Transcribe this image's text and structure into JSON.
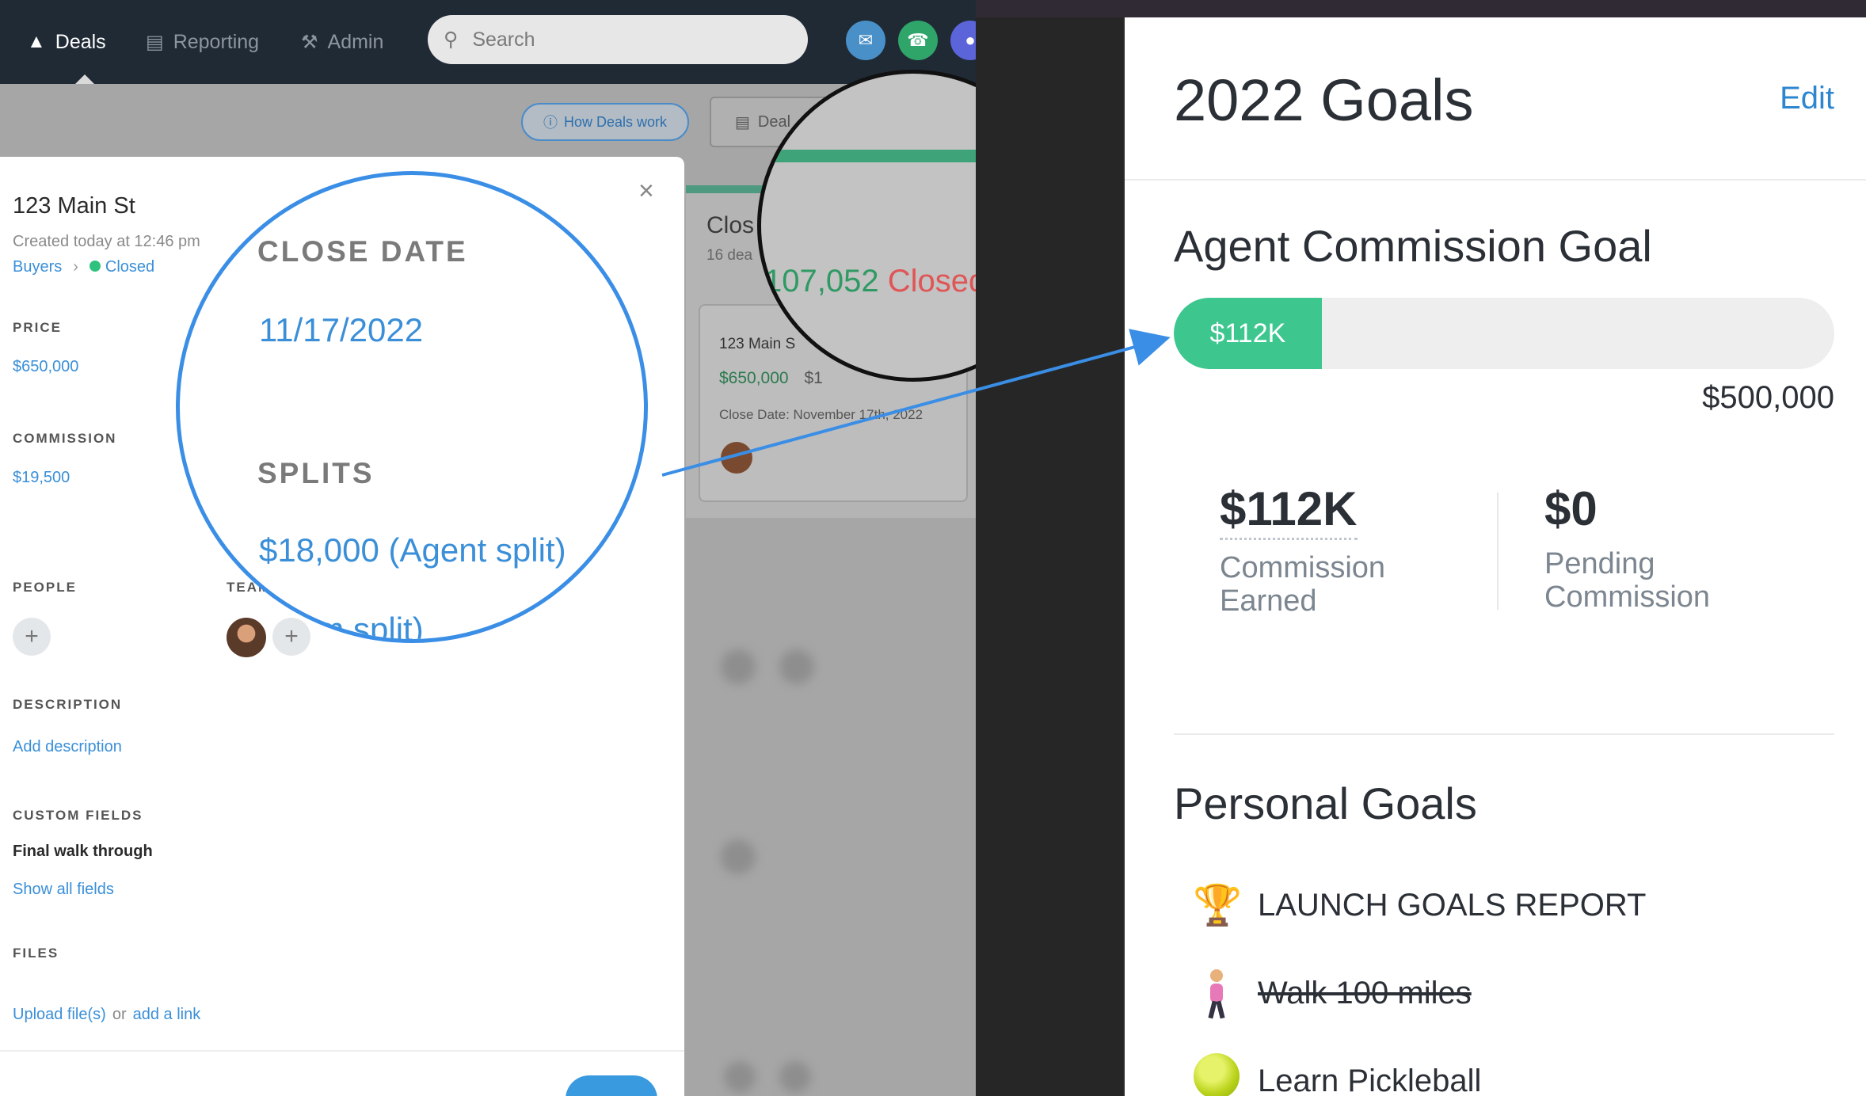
{
  "nav": {
    "items": [
      {
        "label": "Deals",
        "icon": "deals-icon",
        "active": true
      },
      {
        "label": "Reporting",
        "icon": "chart-icon",
        "active": false
      },
      {
        "label": "Admin",
        "icon": "wrench-icon",
        "active": false
      }
    ],
    "search_placeholder": "Search",
    "action_icons": [
      "mail-icon",
      "phone-icon",
      "chat-icon"
    ]
  },
  "toolbar": {
    "how_deals_work": "How Deals work",
    "deals_button": "Deal"
  },
  "board": {
    "column_title": "Clos",
    "column_sub": "16 dea",
    "card_title": "123 Main S",
    "card_price": "$650,000",
    "card_split": "$1",
    "card_close_date": "Close Date: November 17th, 2022"
  },
  "deal": {
    "title": "123 Main St",
    "created": "Created today at 12:46 pm",
    "pipeline": "Buyers",
    "stage": "Closed",
    "price_label": "PRICE",
    "price": "$650,000",
    "commission_label": "COMMISSION",
    "commission": "$19,500",
    "people_label": "PEOPLE",
    "team_label": "TEAM",
    "description_label": "DESCRIPTION",
    "add_description": "Add description",
    "custom_fields_label": "CUSTOM FIELDS",
    "custom_field_value": "Final walk through",
    "show_all_fields": "Show all fields",
    "files_label": "FILES",
    "upload_files": "Upload file(s)",
    "or": "or",
    "add_link": "add a link",
    "close_symbol": "×"
  },
  "magnifier": {
    "close_date_label": "CLOSE DATE",
    "close_date": "11/17/2022",
    "splits_label": "SPLITS",
    "agent_split": "$18,000 (Agent split)",
    "team_split_partial": "(team split)"
  },
  "loupe": {
    "amount": "107,052",
    "status": "Closed"
  },
  "goals": {
    "title": "2022 Goals",
    "edit": "Edit",
    "commission_goal_title": "Agent Commission Goal",
    "progress_label": "$112K",
    "progress_fraction": 0.224,
    "goal_amount": "$500,000",
    "earned_value": "$112K",
    "earned_label_1": "Commission",
    "earned_label_2": "Earned",
    "pending_value": "$0",
    "pending_label_1": "Pending",
    "pending_label_2": "Commission",
    "personal_goals_title": "Personal Goals",
    "personal_goals": [
      {
        "label": "LAUNCH GOALS REPORT",
        "icon": "trophy-icon",
        "emoji": "🏆",
        "done": false
      },
      {
        "label": "Walk 100 miles",
        "icon": "walking-person-icon",
        "done": true
      },
      {
        "label": "Learn Pickleball",
        "icon": "tennis-ball-icon",
        "done": false
      }
    ]
  },
  "colors": {
    "nav_bg": "#1f2a35",
    "link_blue": "#3a8fd8",
    "progress_green": "#3dc78f",
    "closed_green": "#2ec27e",
    "magnifier_ring": "#3a8ee6"
  }
}
